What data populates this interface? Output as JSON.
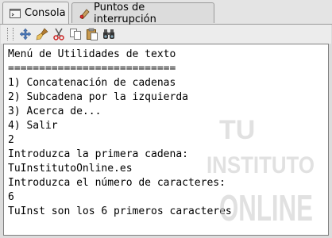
{
  "tabs": [
    {
      "label": "Consola",
      "icon": "console-icon",
      "active": true
    },
    {
      "label": "Puntos de interrupción",
      "icon": "breakpoints-icon",
      "active": false
    }
  ],
  "toolbar": {
    "buttons": [
      {
        "icon": "move-icon"
      },
      {
        "icon": "clear-icon"
      },
      {
        "icon": "cut-icon"
      },
      {
        "icon": "copy-icon"
      },
      {
        "icon": "paste-icon"
      },
      {
        "icon": "find-icon"
      }
    ]
  },
  "console": {
    "lines": [
      "Menú de Utilidades de texto",
      "===========================",
      "1) Concatenación de cadenas",
      "2) Subcadena por la izquierda",
      "3) Acerca de...",
      "4) Salir",
      "2",
      "Introduzca la primera cadena:",
      "TuInstitutoOnline.es",
      "Introduzca el número de caracteres:",
      "6",
      "TuInst son los 6 primeros caracteres"
    ]
  },
  "watermark": {
    "line1": "TU",
    "line2": "INSTITUTO",
    "line3": "ONLINE"
  }
}
